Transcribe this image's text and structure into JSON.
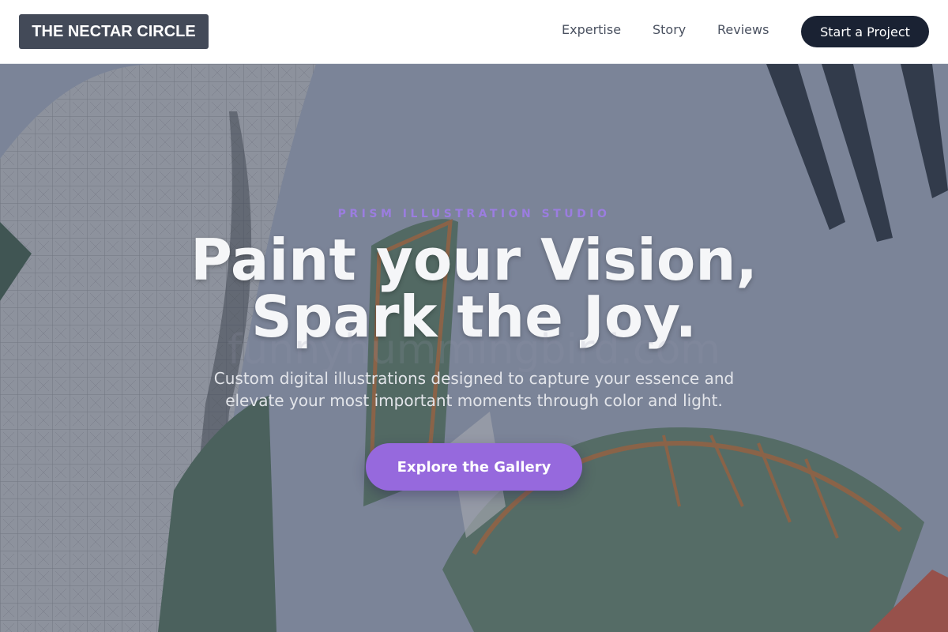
{
  "header": {
    "logo": "THE NECTAR CIRCLE",
    "nav": [
      "Expertise",
      "Story",
      "Reviews"
    ],
    "cta": "Start a Project"
  },
  "hero": {
    "eyebrow": "PRISM ILLUSTRATION STUDIO",
    "headline_line1": "Paint your Vision,",
    "headline_line2": "Spark the Joy.",
    "watermark": "funnyhummingbird.com",
    "subtitle_line1": "Custom digital illustrations designed to capture your essence and",
    "subtitle_line2": "elevate your most important moments through color and light.",
    "cta": "Explore the Gallery"
  },
  "colors": {
    "accent": "#9669dd",
    "header_cta": "#1a2233",
    "logo_bg": "#434a58"
  }
}
